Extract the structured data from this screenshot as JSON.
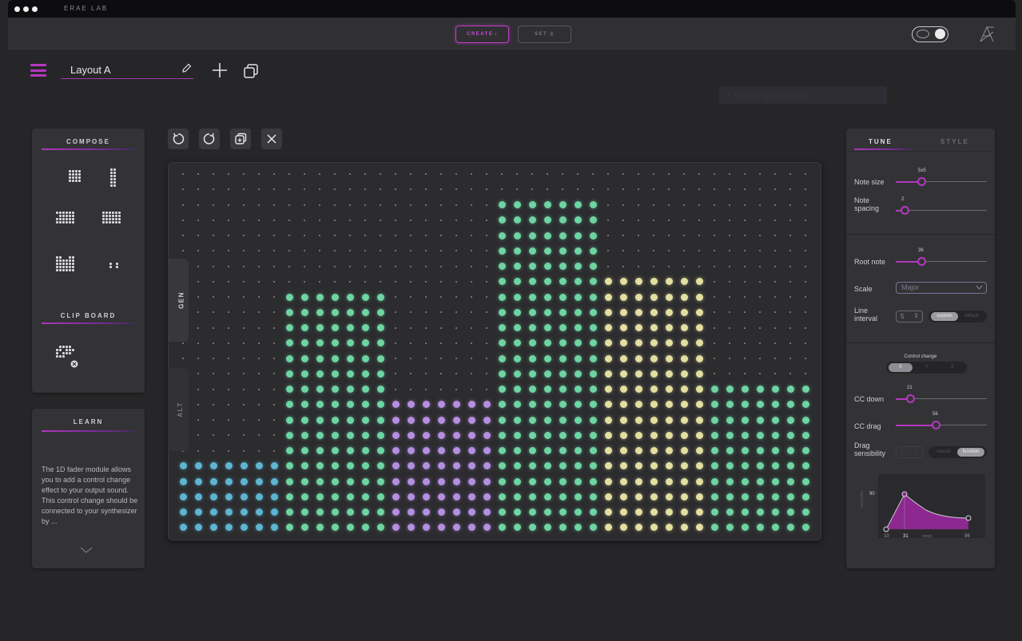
{
  "window": {
    "title": "ERAE LAB"
  },
  "topbar": {
    "create_label": "CREATE",
    "set_label": "SET"
  },
  "layout": {
    "name": "Layout A"
  },
  "compose": {
    "title": "COMPOSE"
  },
  "clipboard": {
    "title": "CLIP BOARD"
  },
  "learn": {
    "title": "LEARN",
    "text": "The 1D fader module allows you to add a control change effect to your output sound. This control change should be connected to your synthesizer by ..."
  },
  "grid": {
    "gen_label": "GEN",
    "alt_label": "ALT",
    "columns": 42,
    "rows": 24,
    "colors": {
      "blue": "#5eb5d2",
      "green": "#6ed4a2",
      "purple": "#b48fe0",
      "yellow": "#e3dfa0",
      "dim": "#8a8a8e"
    },
    "blocks": [
      {
        "color": "blue",
        "col_start": 0,
        "col_end": 6,
        "row_start": 19,
        "row_end": 23
      },
      {
        "color": "green",
        "col_start": 7,
        "col_end": 13,
        "row_start": 8,
        "row_end": 23
      },
      {
        "color": "purple",
        "col_start": 14,
        "col_end": 20,
        "row_start": 15,
        "row_end": 23
      },
      {
        "color": "green",
        "col_start": 21,
        "col_end": 27,
        "row_start": 2,
        "row_end": 23
      },
      {
        "color": "yellow",
        "col_start": 28,
        "col_end": 34,
        "row_start": 7,
        "row_end": 23
      },
      {
        "color": "green",
        "col_start": 35,
        "col_end": 41,
        "row_start": 14,
        "row_end": 23
      }
    ]
  },
  "tune_panel": {
    "tab_tune": "TUNE",
    "tab_style": "STYLE",
    "note_size": {
      "label": "Note size",
      "value": "5x5",
      "fraction": 0.28
    },
    "note_spacing": {
      "label": "Note\nspacing",
      "value": "2",
      "fraction": 0.1
    },
    "root_note": {
      "label": "Root note",
      "value": "36",
      "fraction": 0.28
    },
    "scale": {
      "label": "Scale",
      "value": "Major"
    },
    "line_interval": {
      "label": "Line\ninterval",
      "value": "5",
      "custom": "custom",
      "default": "default"
    },
    "control_change": {
      "label": "Control change",
      "options": [
        "X",
        "Y",
        "Z"
      ],
      "selected": "X"
    },
    "cc_down": {
      "label": "CC down",
      "value": "21",
      "fraction": 0.16
    },
    "cc_drag": {
      "label": "CC drag",
      "value": "56",
      "fraction": 0.44
    },
    "drag_sensibility": {
      "label": "Drag\nsensibility",
      "value": "5",
      "classic": "classic",
      "function": "function"
    },
    "curve": {
      "ylabel": "sensibility",
      "xlabel": "range",
      "y_value": "90",
      "x_min": "10",
      "x_peak": "31",
      "x_max": "96"
    }
  }
}
